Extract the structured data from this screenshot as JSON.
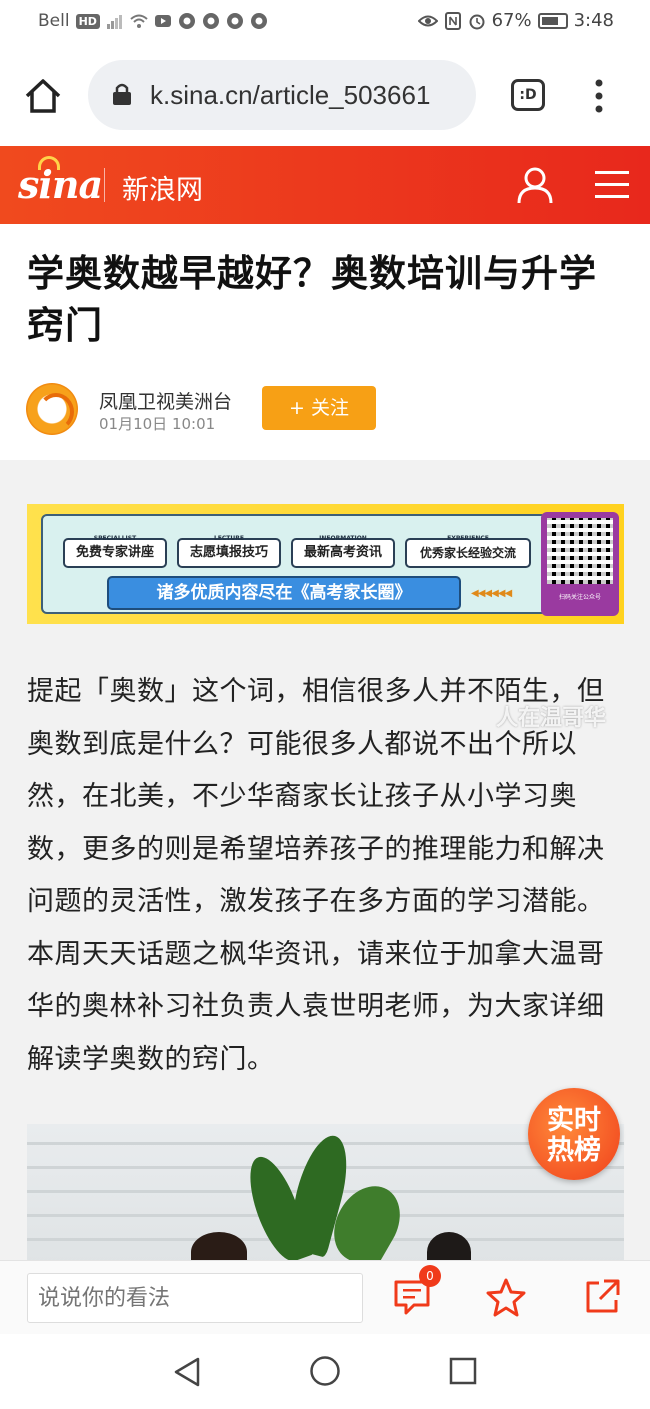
{
  "status_bar": {
    "carrier": "Bell",
    "network_badge": "HD",
    "battery_percent": "67%",
    "time": "3:48",
    "icons": [
      "signal-icon",
      "wifi-icon",
      "youtube-icon",
      "chrome-icon",
      "chrome-icon",
      "chrome-icon",
      "chrome-icon",
      "eye-icon",
      "nfc-icon",
      "alarm-icon",
      "battery-icon"
    ]
  },
  "browser": {
    "url": "k.sina.cn/article_503661",
    "tabs_label": ":D"
  },
  "site_header": {
    "logo_text": "sina",
    "site_name": "新浪网"
  },
  "article": {
    "title": "学奥数越早越好？奥数培训与升学窍门",
    "author": "凤凰卫视美洲台",
    "publish_time": "01月10日  10:01",
    "follow_label": "+ 关注",
    "body": "提起「奥数」这个词，相信很多人并不陌生，但奥数到底是什么？可能很多人都说不出个所以然，在北美，不少华裔家长让孩子从小学习奥数，更多的则是希望培养孩子的推理能力和解决问题的灵活性，激发孩子在多方面的学习潜能。本周天天话题之枫华资讯，请来位于加拿大温哥华的奥林补习社负责人袁世明老师，为大家详细解读学奥数的窍门。"
  },
  "banner": {
    "tags": [
      {
        "sub": "SPECIALLIST",
        "label": "免费专家讲座"
      },
      {
        "sub": "LECTURE",
        "label": "志愿填报技巧"
      },
      {
        "sub": "INFORMATION",
        "label": "最新高考资讯"
      },
      {
        "sub": "EXPERIENCE",
        "label": "优秀家长经验交流"
      }
    ],
    "slogan": "诸多优质内容尽在《高考家长圈》",
    "qr_caption": "扫码关注公众号"
  },
  "watermark": "人在温哥华",
  "hot_badge": {
    "line1": "实时",
    "line2": "热榜"
  },
  "comment_bar": {
    "placeholder": "说说你的看法",
    "comment_count": "0"
  },
  "colors": {
    "sina_red": "#e8281c",
    "follow_orange": "#f7a015",
    "action_red": "#f03a1a"
  }
}
